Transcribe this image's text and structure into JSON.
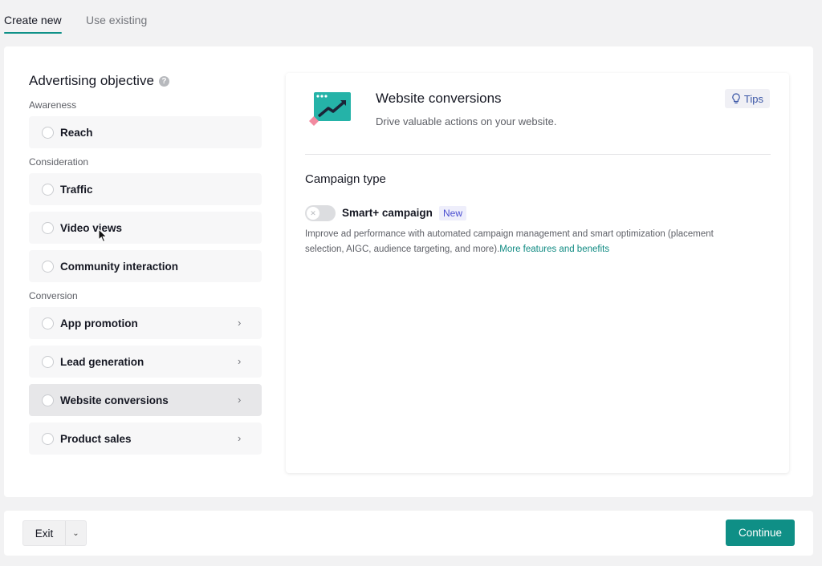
{
  "tabs": [
    {
      "label": "Create new",
      "active": true
    },
    {
      "label": "Use existing",
      "active": false
    }
  ],
  "objective": {
    "title": "Advertising objective",
    "groups": [
      {
        "label": "Awareness",
        "options": [
          {
            "label": "Reach",
            "chevron": false,
            "selected": false
          }
        ]
      },
      {
        "label": "Consideration",
        "options": [
          {
            "label": "Traffic",
            "chevron": false,
            "selected": false
          },
          {
            "label": "Video views",
            "chevron": false,
            "selected": false
          },
          {
            "label": "Community interaction",
            "chevron": false,
            "selected": false
          }
        ]
      },
      {
        "label": "Conversion",
        "options": [
          {
            "label": "App promotion",
            "chevron": true,
            "selected": false
          },
          {
            "label": "Lead generation",
            "chevron": true,
            "selected": false
          },
          {
            "label": "Website conversions",
            "chevron": true,
            "selected": true
          },
          {
            "label": "Product sales",
            "chevron": true,
            "selected": false
          }
        ]
      }
    ]
  },
  "detail": {
    "title": "Website conversions",
    "subtitle": "Drive valuable actions on your website.",
    "tips_label": "Tips",
    "campaign_type_title": "Campaign type",
    "smart_label": "Smart+ campaign",
    "new_badge": "New",
    "smart_desc": "Improve ad performance with automated campaign management and smart optimization (placement selection, AIGC, audience targeting, and more).",
    "smart_link": "More features and benefits",
    "toggle_on": false
  },
  "footer": {
    "exit_label": "Exit",
    "continue_label": "Continue"
  },
  "colors": {
    "accent": "#0f8f86",
    "tips_text": "#3a56a6",
    "new_badge": "#4a4ed0"
  }
}
